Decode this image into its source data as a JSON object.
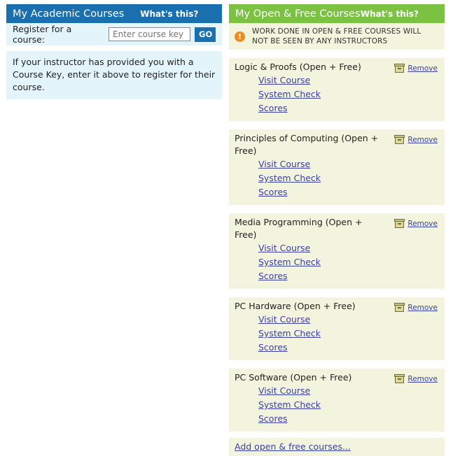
{
  "academic": {
    "title": "My Academic Courses",
    "whats_this": "What's this?",
    "register_label": "Register for a course:",
    "course_key_placeholder": "Enter course key",
    "go_label": "GO",
    "info": "If your instructor has provided you with a Course Key, enter it above to register for their course."
  },
  "open_free": {
    "title": "My Open & Free Courses",
    "whats_this": "What's this?",
    "warning": "WORK DONE IN OPEN & FREE COURSES WILL NOT BE SEEN BY ANY INSTRUCTORS",
    "warning_icon": "exclamation-icon",
    "remove_label": "Remove",
    "courses": [
      {
        "title": "Logic & Proofs (Open + Free)",
        "links": [
          "Visit Course",
          "System Check",
          "Scores"
        ]
      },
      {
        "title": "Principles of Computing (Open + Free)",
        "links": [
          "Visit Course",
          "System Check",
          "Scores"
        ]
      },
      {
        "title": "Media Programming (Open + Free)",
        "links": [
          "Visit Course",
          "System Check",
          "Scores"
        ]
      },
      {
        "title": "PC Hardware (Open + Free)",
        "links": [
          "Visit Course",
          "System Check",
          "Scores"
        ]
      },
      {
        "title": "PC Software (Open + Free)",
        "links": [
          "Visit Course",
          "System Check",
          "Scores"
        ]
      }
    ],
    "add_link": "Add open & free courses..."
  },
  "colors": {
    "academic_header": "#1a6faf",
    "academic_panel": "#e3f4fb",
    "open_header": "#7cc242",
    "open_panel": "#f2f4dd",
    "warning_icon": "#f08c1e",
    "link": "#3b3f9e"
  }
}
